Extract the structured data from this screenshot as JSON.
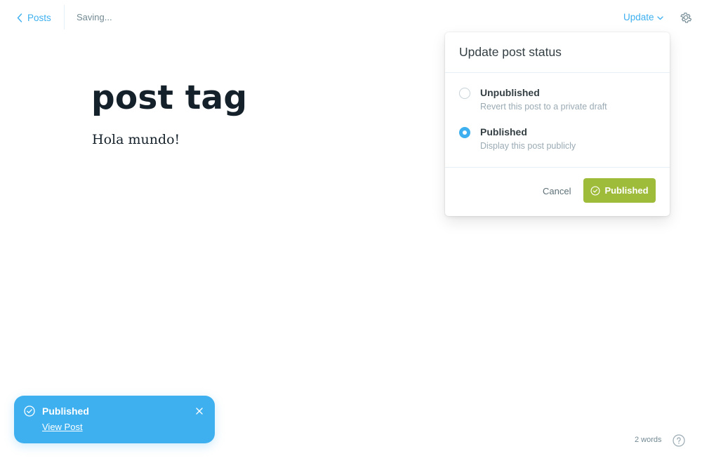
{
  "header": {
    "back_label": "Posts",
    "saving_status": "Saving...",
    "update_label": "Update"
  },
  "post": {
    "title": "post tag",
    "body": "Hola mundo!"
  },
  "status_popover": {
    "title": "Update post status",
    "options": [
      {
        "label": "Unpublished",
        "description": "Revert this post to a private draft",
        "selected": false
      },
      {
        "label": "Published",
        "description": "Display this post publicly",
        "selected": true
      }
    ],
    "cancel_label": "Cancel",
    "confirm_label": "Published"
  },
  "toast": {
    "title": "Published",
    "link_label": "View Post"
  },
  "footer": {
    "word_count": "2 words"
  },
  "icons": {
    "back": "chevron-left-icon",
    "update_dropdown": "chevron-down-icon",
    "settings": "gear-icon",
    "publish_check": "check-circle-icon",
    "toast_check": "check-circle-icon",
    "toast_close": "close-icon",
    "help": "help-circle-icon"
  },
  "colors": {
    "accent_blue": "#3eb0ef",
    "publish_green": "#9fbb3a",
    "text_dark": "#15212a",
    "text_muted": "#9aaab4"
  }
}
